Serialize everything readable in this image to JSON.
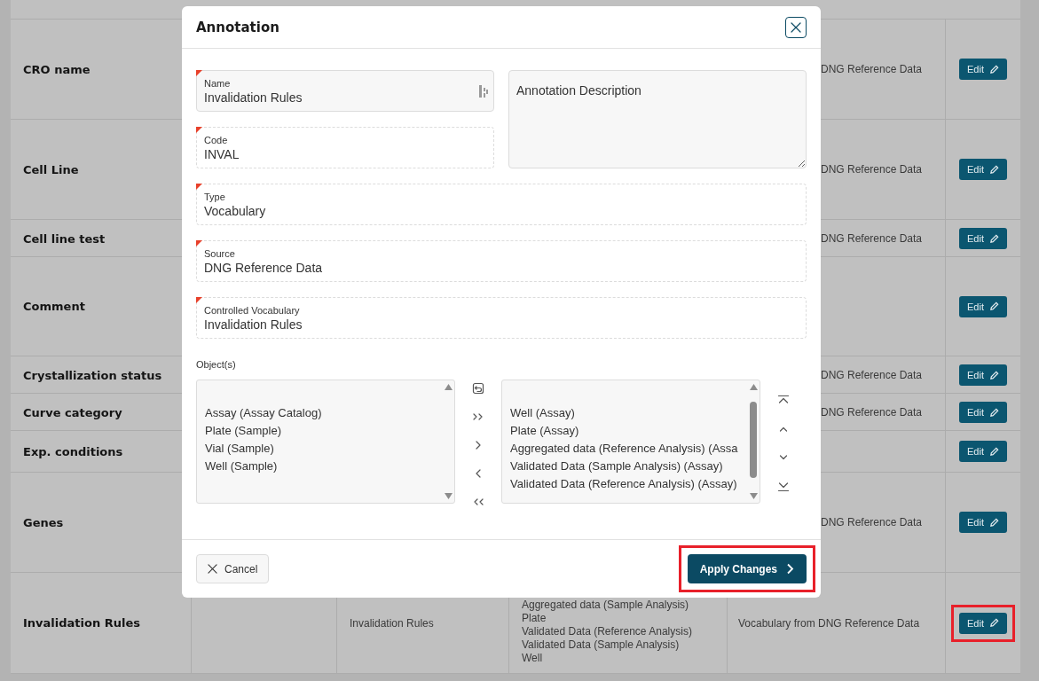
{
  "table": {
    "rows": [
      {
        "name": "CRO name",
        "column_5": "DNG Reference Data",
        "action": "Edit",
        "highlighted": false
      },
      {
        "name": "Cell Line",
        "column_5": "DNG Reference Data",
        "action": "Edit",
        "highlighted": false
      },
      {
        "name": "Cell line test",
        "column_5": "DNG Reference Data",
        "action": "Edit",
        "highlighted": false
      },
      {
        "name": "Comment",
        "action": "Edit",
        "highlighted": false
      },
      {
        "name": "Crystallization status",
        "column_5": "DNG Reference Data",
        "action": "Edit",
        "highlighted": false
      },
      {
        "name": "Curve category",
        "column_5": "DNG Reference Data",
        "action": "Edit",
        "highlighted": false
      },
      {
        "name": "Exp. conditions",
        "action": "Edit",
        "highlighted": false
      },
      {
        "name": "Genes",
        "column_5": "DNG Reference Data",
        "action": "Edit",
        "highlighted": false
      },
      {
        "name": "Invalidation Rules",
        "column_3": "Invalidation Rules",
        "column_4": [
          "Aggregated data (Sample Analysis)",
          "Plate",
          "Validated Data (Reference Analysis)",
          "Validated Data (Sample Analysis)",
          "Well"
        ],
        "column_5": "Vocabulary from DNG Reference Data",
        "action": "Edit",
        "highlighted": true
      }
    ]
  },
  "dialog": {
    "title": "Annotation",
    "name": {
      "label": "Name",
      "value": "Invalidation Rules",
      "required": true,
      "disabled": false
    },
    "description": {
      "placeholder": "Annotation Description"
    },
    "fields": [
      {
        "label": "Code",
        "value": "INVAL",
        "required": true,
        "disabled": true
      },
      {
        "label": "Type",
        "value": "Vocabulary",
        "required": true,
        "disabled": true
      },
      {
        "label": "Source",
        "value": "DNG Reference Data",
        "required": true,
        "disabled": true
      },
      {
        "label": "Controlled Vocabulary",
        "value": "Invalidation Rules",
        "required": true,
        "disabled": true
      }
    ],
    "objects": {
      "label": "Object(s)",
      "available": [
        "Assay (Assay Catalog)",
        "Plate (Sample)",
        "Vial (Sample)",
        "Well (Sample)"
      ],
      "chosen": [
        "Well (Assay)",
        "Plate (Assay)",
        "Aggregated data (Reference Analysis) (Assa",
        "Validated Data (Sample Analysis) (Assay)",
        "Validated Data (Reference Analysis) (Assay)"
      ]
    },
    "cancel": "Cancel",
    "apply": {
      "label": "Apply Changes",
      "highlighted": true
    }
  }
}
